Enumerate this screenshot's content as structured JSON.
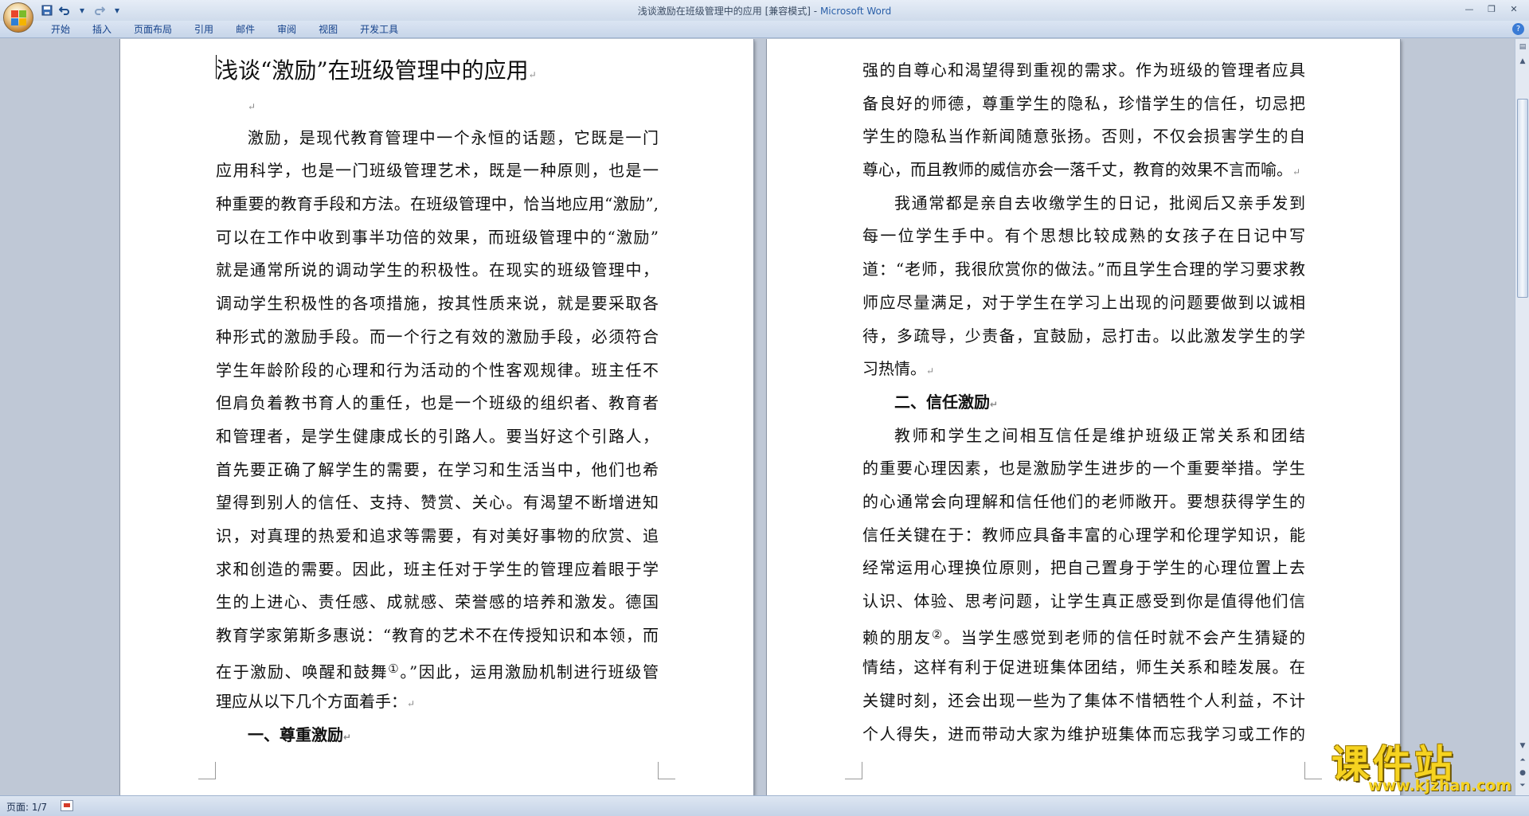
{
  "window": {
    "title": "浅谈激励在班级管理中的应用 [兼容模式]",
    "separator": " - ",
    "app_name": "Microsoft Word"
  },
  "quick_access": {
    "save_icon": "save-icon",
    "undo_icon": "undo-icon",
    "redo_icon": "redo-icon"
  },
  "ribbon": {
    "tabs": [
      "开始",
      "插入",
      "页面布局",
      "引用",
      "邮件",
      "审阅",
      "视图",
      "开发工具"
    ]
  },
  "document": {
    "title": "浅谈“激励”在班级管理中的应用",
    "page1_lines": [
      "激励，是现代教育管理中一个永恒的话题，它既是一门",
      "应用科学，也是一门班级管理艺术，既是一种原则，也是一",
      "种重要的教育手段和方法。在班级管理中，恰当地应用“激励”,",
      "可以在工作中收到事半功倍的效果，而班级管理中的“激励”",
      "就是通常所说的调动学生的积极性。在现实的班级管理中，",
      "调动学生积极性的各项措施，按其性质来说，就是要采取各",
      "种形式的激励手段。而一个行之有效的激励手段，必须符合",
      "学生年龄阶段的心理和行为活动的个性客观规律。班主任不",
      "但肩负着教书育人的重任，也是一个班级的组织者、教育者",
      "和管理者，是学生健康成长的引路人。要当好这个引路人，",
      "首先要正确了解学生的需要，在学习和生活当中，他们也希",
      "望得到别人的信任、支持、赞赏、关心。有渴望不断增进知",
      "识，对真理的热爱和追求等需要，有对美好事物的欣赏、追",
      "求和创造的需要。因此，班主任对于学生的管理应着眼于学",
      "生的上进心、责任感、成就感、荣誉感的培养和激发。德国",
      "教育学家第斯多惠说：“教育的艺术不在传授知识和本领，而"
    ],
    "p1_fn_line_before": "在于激励、唤醒和鼓舞",
    "p1_fn_mark": "①",
    "p1_fn_line_after": "。”因此，运用激励机制进行班级管",
    "p1_last_line": "理应从以下几个方面着手：",
    "heading1": "一、尊重激励",
    "page2_lines_a": [
      "强的自尊心和渴望得到重视的需求。作为班级的管理者应具",
      "备良好的师德，尊重学生的隐私，珍惜学生的信任，切忌把",
      "学生的隐私当作新闻随意张扬。否则，不仅会损害学生的自"
    ],
    "p2_para1_last": "尊心，而且教师的威信亦会一落千丈，教育的效果不言而喻。",
    "page2_lines_b": [
      "我通常都是亲自去收缴学生的日记，批阅后又亲手发到",
      "每一位学生手中。有个思想比较成熟的女孩子在日记中写",
      "道：“老师，我很欣赏你的做法。”而且学生合理的学习要求教",
      "师应尽量满足，对于学生在学习上出现的问题要做到以诚相",
      "待，多疏导，少责备，宜鼓励，忌打击。以此激发学生的学"
    ],
    "p2_para2_last": "习热情。",
    "heading2": "二、信任激励",
    "page2_lines_c": [
      "教师和学生之间相互信任是维护班级正常关系和团结",
      "的重要心理因素，也是激励学生进步的一个重要举措。学生",
      "的心通常会向理解和信任他们的老师敞开。要想获得学生的",
      "信任关键在于：教师应具备丰富的心理学和伦理学知识，能",
      "经常运用心理换位原则，把自己置身于学生的心理位置上去",
      "认识、体验、思考问题，让学生真正感受到你是值得他们信"
    ],
    "p2_fn_line_before": "赖的朋友",
    "p2_fn_mark": "②",
    "p2_fn_line_after": "。当学生感觉到老师的信任时就不会产生猜疑的",
    "page2_lines_d": [
      "情结，这样有利于促进班集体团结，师生关系和睦发展。在",
      "关键时刻，还会出现一些为了集体不惜牺牲个人利益，不计",
      "个人得失，进而带动大家为维护班集体而忘我学习或工作的"
    ],
    "paragraph_mark": "↵"
  },
  "status": {
    "page_label": "页面: 1/7"
  },
  "watermark": {
    "main": "课件站",
    "url": "www.kjzhan.com"
  }
}
